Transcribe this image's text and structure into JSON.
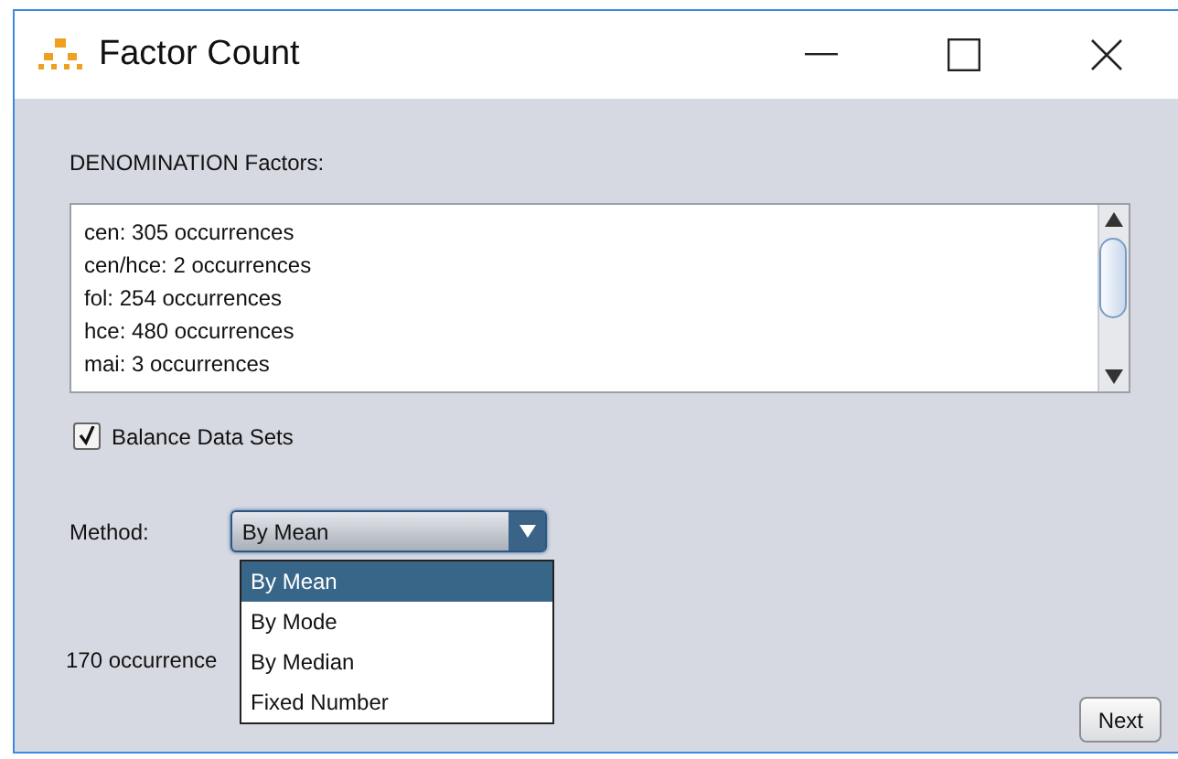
{
  "window": {
    "title": "Factor Count"
  },
  "factors_label": "DENOMINATION Factors:",
  "factors": [
    "cen: 305 occurrences",
    "cen/hce: 2 occurrences",
    "fol: 254 occurrences",
    "hce: 480 occurrences",
    "mai: 3 occurrences"
  ],
  "balance": {
    "label": "Balance Data Sets",
    "checked": true
  },
  "method": {
    "label": "Method:",
    "value": "By Mean",
    "expanded": true,
    "options": [
      {
        "label": "By Mean",
        "selected": true
      },
      {
        "label": "By Mode",
        "selected": false
      },
      {
        "label": "By Median",
        "selected": false
      },
      {
        "label": "Fixed Number",
        "selected": false
      }
    ]
  },
  "result": "170 occurrence",
  "buttons": [
    "Next"
  ]
}
